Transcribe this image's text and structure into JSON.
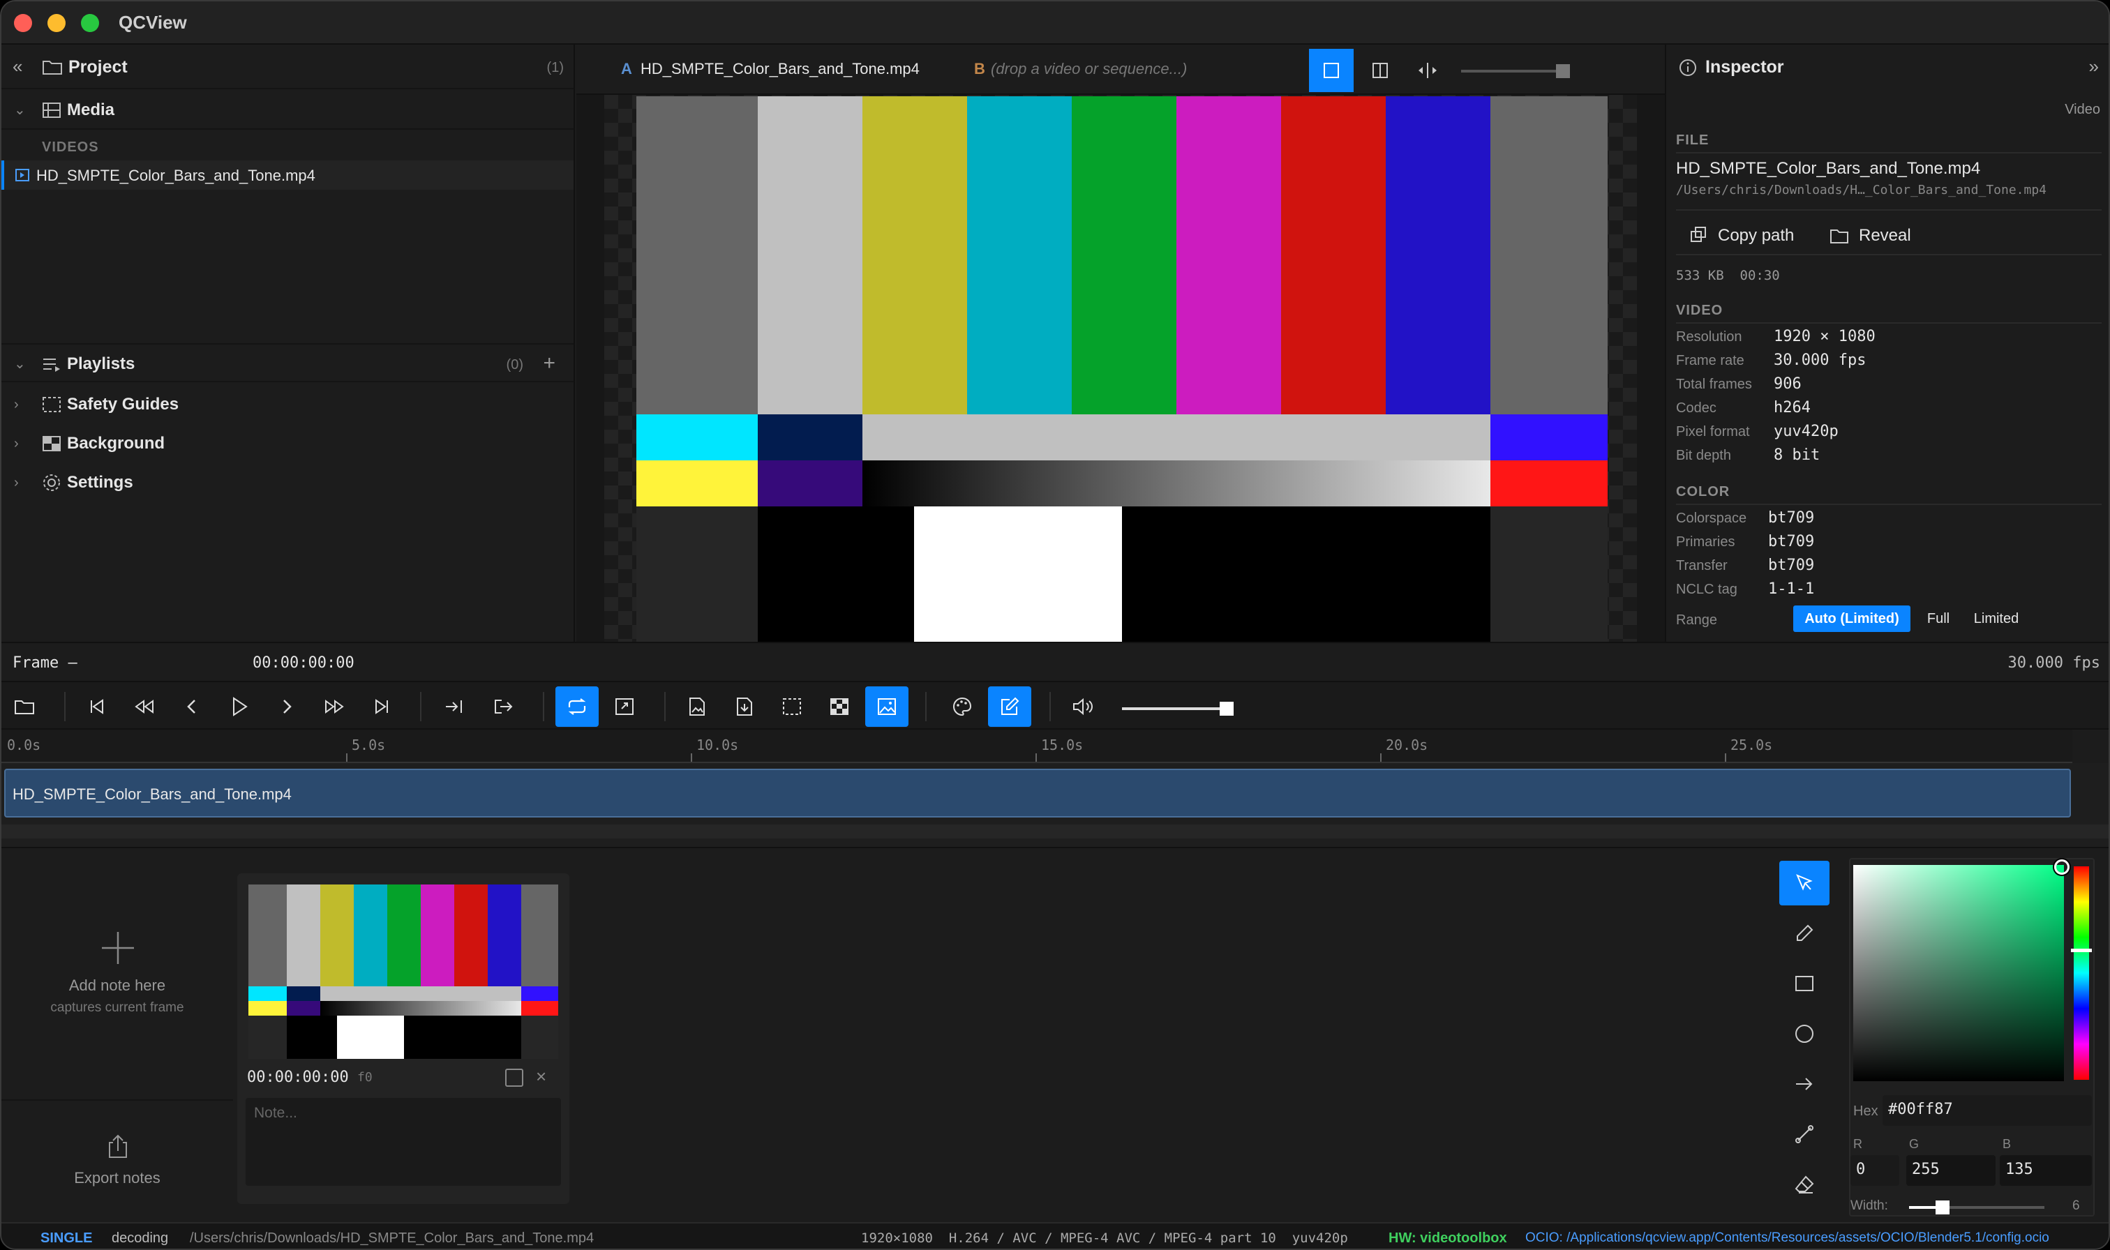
{
  "app": {
    "title": "QCView"
  },
  "left": {
    "project": {
      "title": "Project",
      "count": "(1)"
    },
    "media": {
      "title": "Media",
      "group": "VIDEOS",
      "items": [
        "HD_SMPTE_Color_Bars_and_Tone.mp4"
      ]
    },
    "playlists": {
      "title": "Playlists",
      "count": "(0)",
      "add": "+"
    },
    "sections": [
      "Safety Guides",
      "Background",
      "Settings"
    ]
  },
  "viewer": {
    "slot_a": {
      "letter": "A",
      "name": "HD_SMPTE_Color_Bars_and_Tone.mp4"
    },
    "slot_b": {
      "letter": "B",
      "placeholder": "(drop a video or sequence...)"
    }
  },
  "inspector": {
    "title": "Inspector",
    "tab": "Video",
    "file_label": "FILE",
    "file_name": "HD_SMPTE_Color_Bars_and_Tone.mp4",
    "file_path": "/Users/chris/Downloads/H…_Color_Bars_and_Tone.mp4",
    "copy_path": "Copy path",
    "reveal": "Reveal",
    "size_duration": "533 KB  00:30",
    "video_label": "VIDEO",
    "video": [
      {
        "k": "Resolution",
        "v": "1920 × 1080"
      },
      {
        "k": "Frame rate",
        "v": "30.000 fps"
      },
      {
        "k": "Total frames",
        "v": "906"
      },
      {
        "k": "Codec",
        "v": "h264"
      },
      {
        "k": "Pixel format",
        "v": "yuv420p"
      },
      {
        "k": "Bit depth",
        "v": "8 bit"
      }
    ],
    "color_label": "COLOR",
    "color": [
      {
        "k": "Colorspace",
        "v": "bt709"
      },
      {
        "k": "Primaries",
        "v": "bt709"
      },
      {
        "k": "Transfer",
        "v": "bt709"
      },
      {
        "k": "NCLC tag",
        "v": "1-1-1"
      }
    ],
    "range_label": "Range",
    "range_options": [
      "Auto (Limited)",
      "Full",
      "Limited"
    ]
  },
  "framebar": {
    "frame": "Frame –",
    "timecode": "00:00:00:00",
    "fps": "30.000 fps"
  },
  "timeline": {
    "ticks": [
      "0.0s",
      "5.0s",
      "10.0s",
      "15.0s",
      "20.0s",
      "25.0s"
    ],
    "clip": "HD_SMPTE_Color_Bars_and_Tone.mp4"
  },
  "notes": {
    "add_title": "Add note here",
    "add_sub": "captures current frame",
    "export": "Export notes",
    "card": {
      "timecode": "00:00:00:00",
      "frame": "f0",
      "placeholder": "Note..."
    }
  },
  "picker": {
    "hex_label": "Hex",
    "hex": "#00ff87",
    "r_label": "R",
    "g_label": "G",
    "b_label": "B",
    "r": "0",
    "g": "255",
    "b": "135",
    "width_label": "Width:",
    "width": "6",
    "accent": "#00ff87"
  },
  "status": {
    "mode": "SINGLE",
    "state": "decoding",
    "path": "/Users/chris/Downloads/HD_SMPTE_Color_Bars_and_Tone.mp4",
    "info": "1920×1080  H.264 / AVC / MPEG-4 AVC / MPEG-4 part 10  yuv420p",
    "hw": "HW: videotoolbox",
    "ocio": "OCIO: /Applications/qcview.app/Contents/Resources/assets/OCIO/Blender5.1/config.ocio"
  }
}
